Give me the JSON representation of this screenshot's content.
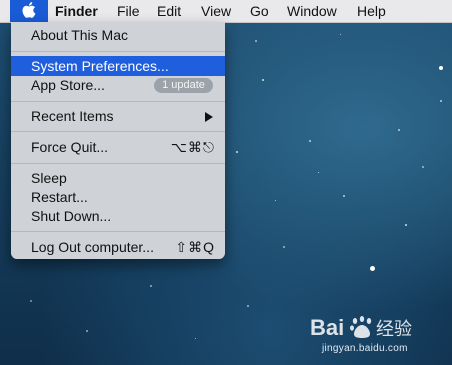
{
  "menubar": {
    "apple_icon": "apple-logo-icon",
    "items": [
      "Finder",
      "File",
      "Edit",
      "View",
      "Go",
      "Window",
      "Help"
    ]
  },
  "apple_menu": {
    "about": "About This Mac",
    "system_preferences": "System Preferences...",
    "app_store": "App Store...",
    "app_store_badge": "1 update",
    "recent_items": "Recent Items",
    "force_quit": "Force Quit...",
    "force_quit_shortcut": "⌥⌘⎋",
    "sleep": "Sleep",
    "restart": "Restart...",
    "shut_down": "Shut Down...",
    "log_out": "Log Out computer...",
    "log_out_shortcut": "⇧⌘Q"
  },
  "watermark": {
    "logo_text": "Bai 经验",
    "url": "jingyan.baidu.com"
  },
  "colors": {
    "highlight": "#1f5edc",
    "menu_background": "#cfd3d8",
    "menubar_background": "#e9e9ec"
  }
}
